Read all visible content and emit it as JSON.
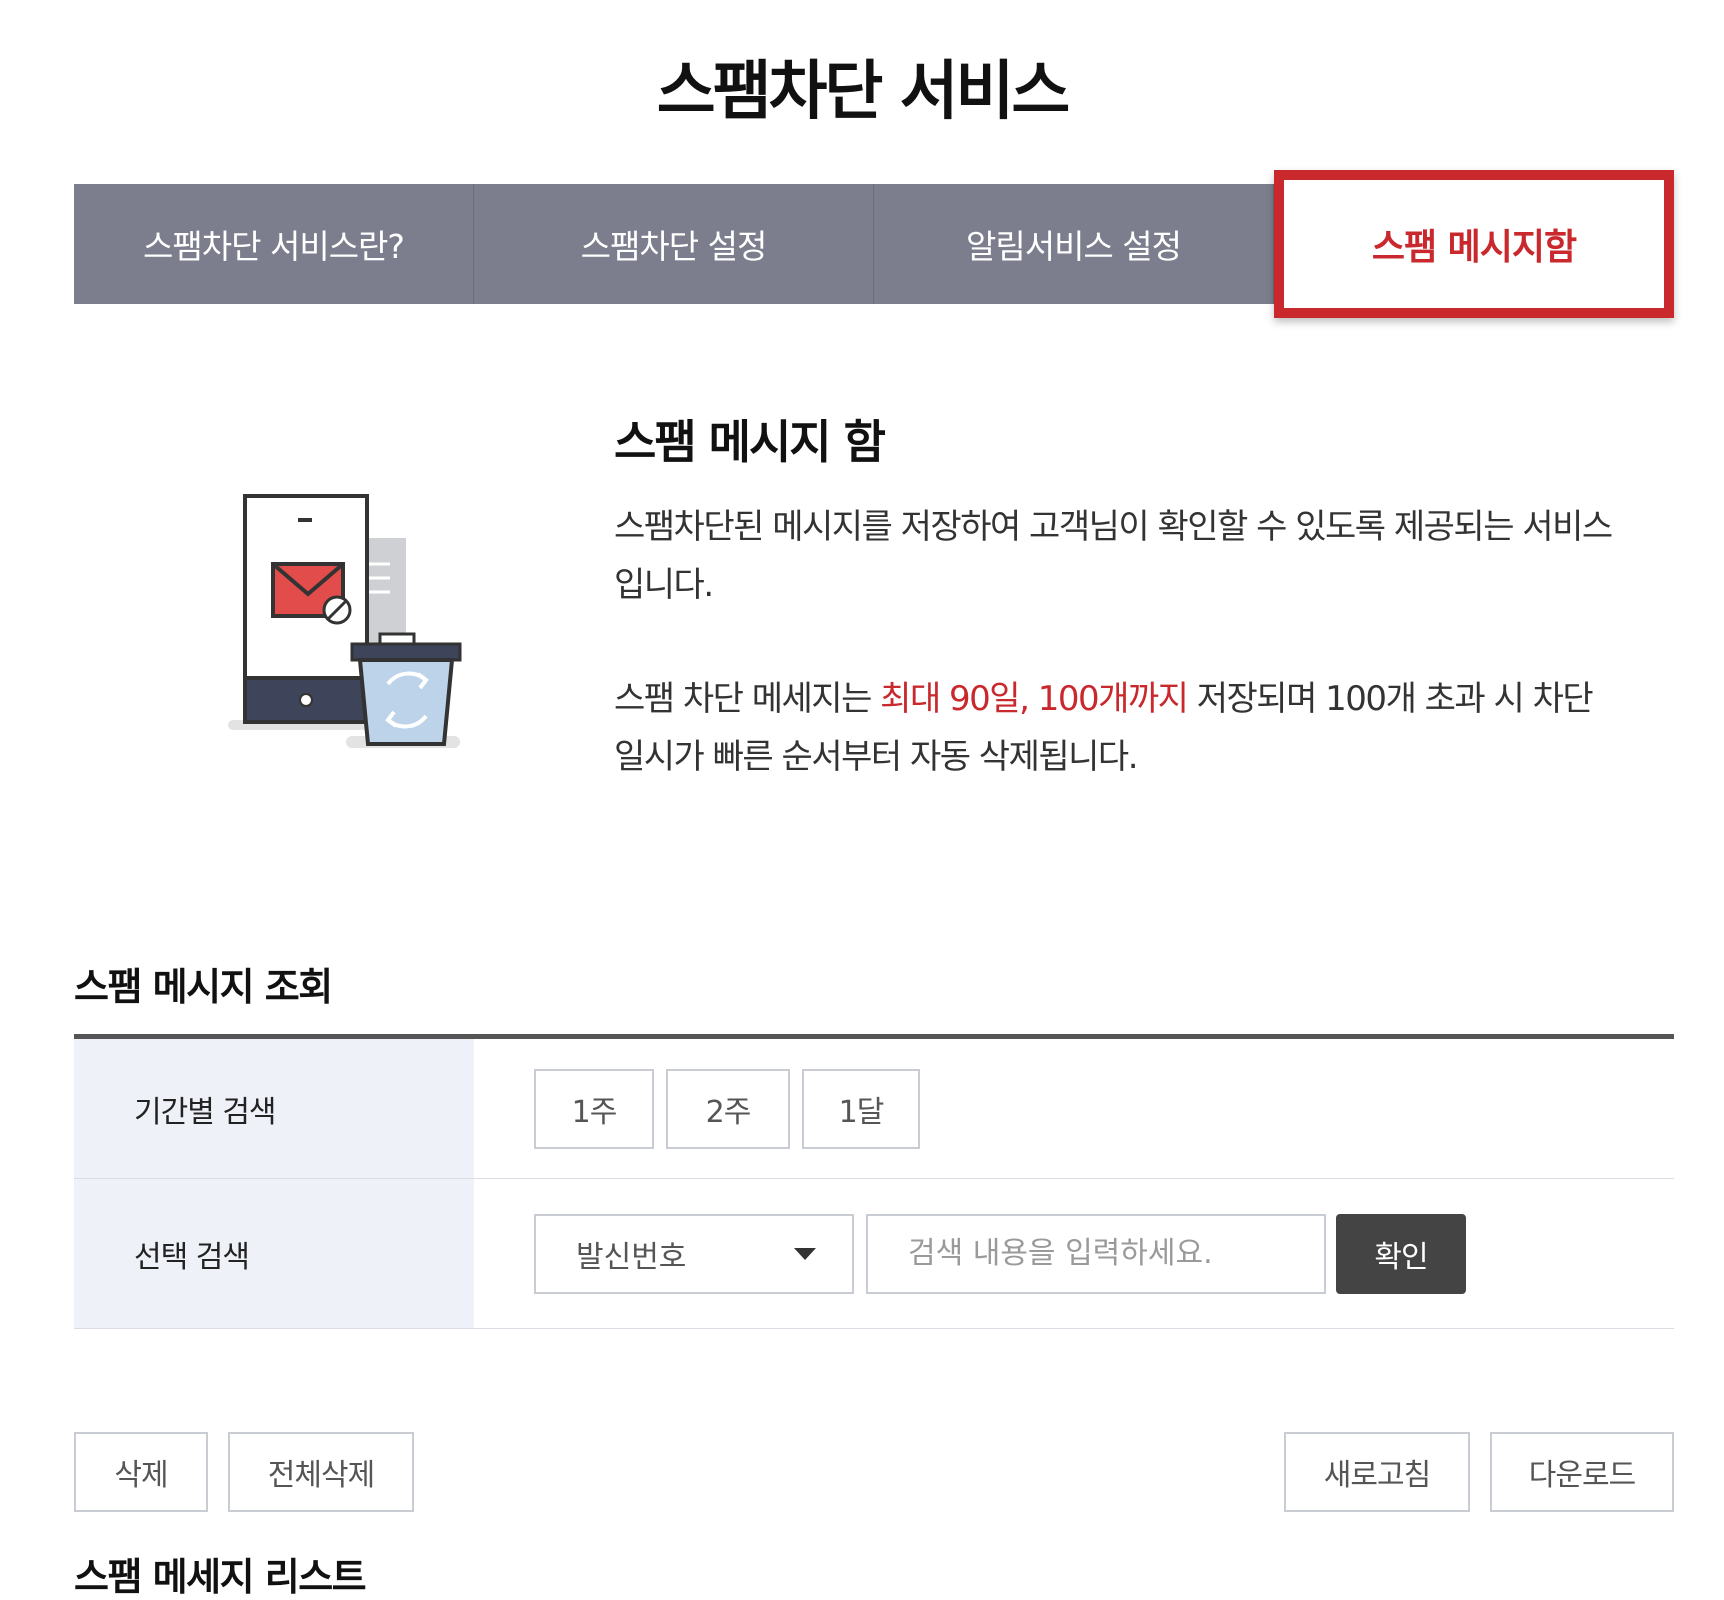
{
  "page": {
    "title": "스팸차단 서비스"
  },
  "tabs": [
    {
      "label": "스팸차단 서비스란?"
    },
    {
      "label": "스팸차단 설정"
    },
    {
      "label": "알림서비스 설정"
    },
    {
      "label": "스팸 메시지함",
      "active": true
    }
  ],
  "intro": {
    "title": "스팸 메시지 함",
    "paragraph1": "스팸차단된 메시지를 저장하여 고객님이 확인할 수 있도록 제공되는 서비스입니다.",
    "paragraph2_before": "스팸 차단 메세지는 ",
    "paragraph2_highlight": "최대 90일, 100개까지",
    "paragraph2_after": " 저장되며 100개 초과 시 차단 일시가 빠른 순서부터 자동 삭제됩니다."
  },
  "search": {
    "section_title": "스팸 메시지 조회",
    "period_label": "기간별 검색",
    "period_buttons": [
      "1주",
      "2주",
      "1달"
    ],
    "select_label": "선택 검색",
    "select_value": "발신번호",
    "input_placeholder": "검색 내용을 입력하세요.",
    "confirm_label": "확인"
  },
  "actions": {
    "delete_label": "삭제",
    "delete_all_label": "전체삭제",
    "refresh_label": "새로고침",
    "download_label": "다운로드"
  },
  "list": {
    "section_title": "스팸 메세지 리스트"
  },
  "colors": {
    "accent": "#c9282d",
    "tab_bg": "#7c7e8d",
    "label_bg": "#eff1f8",
    "confirm_bg": "#444444"
  }
}
